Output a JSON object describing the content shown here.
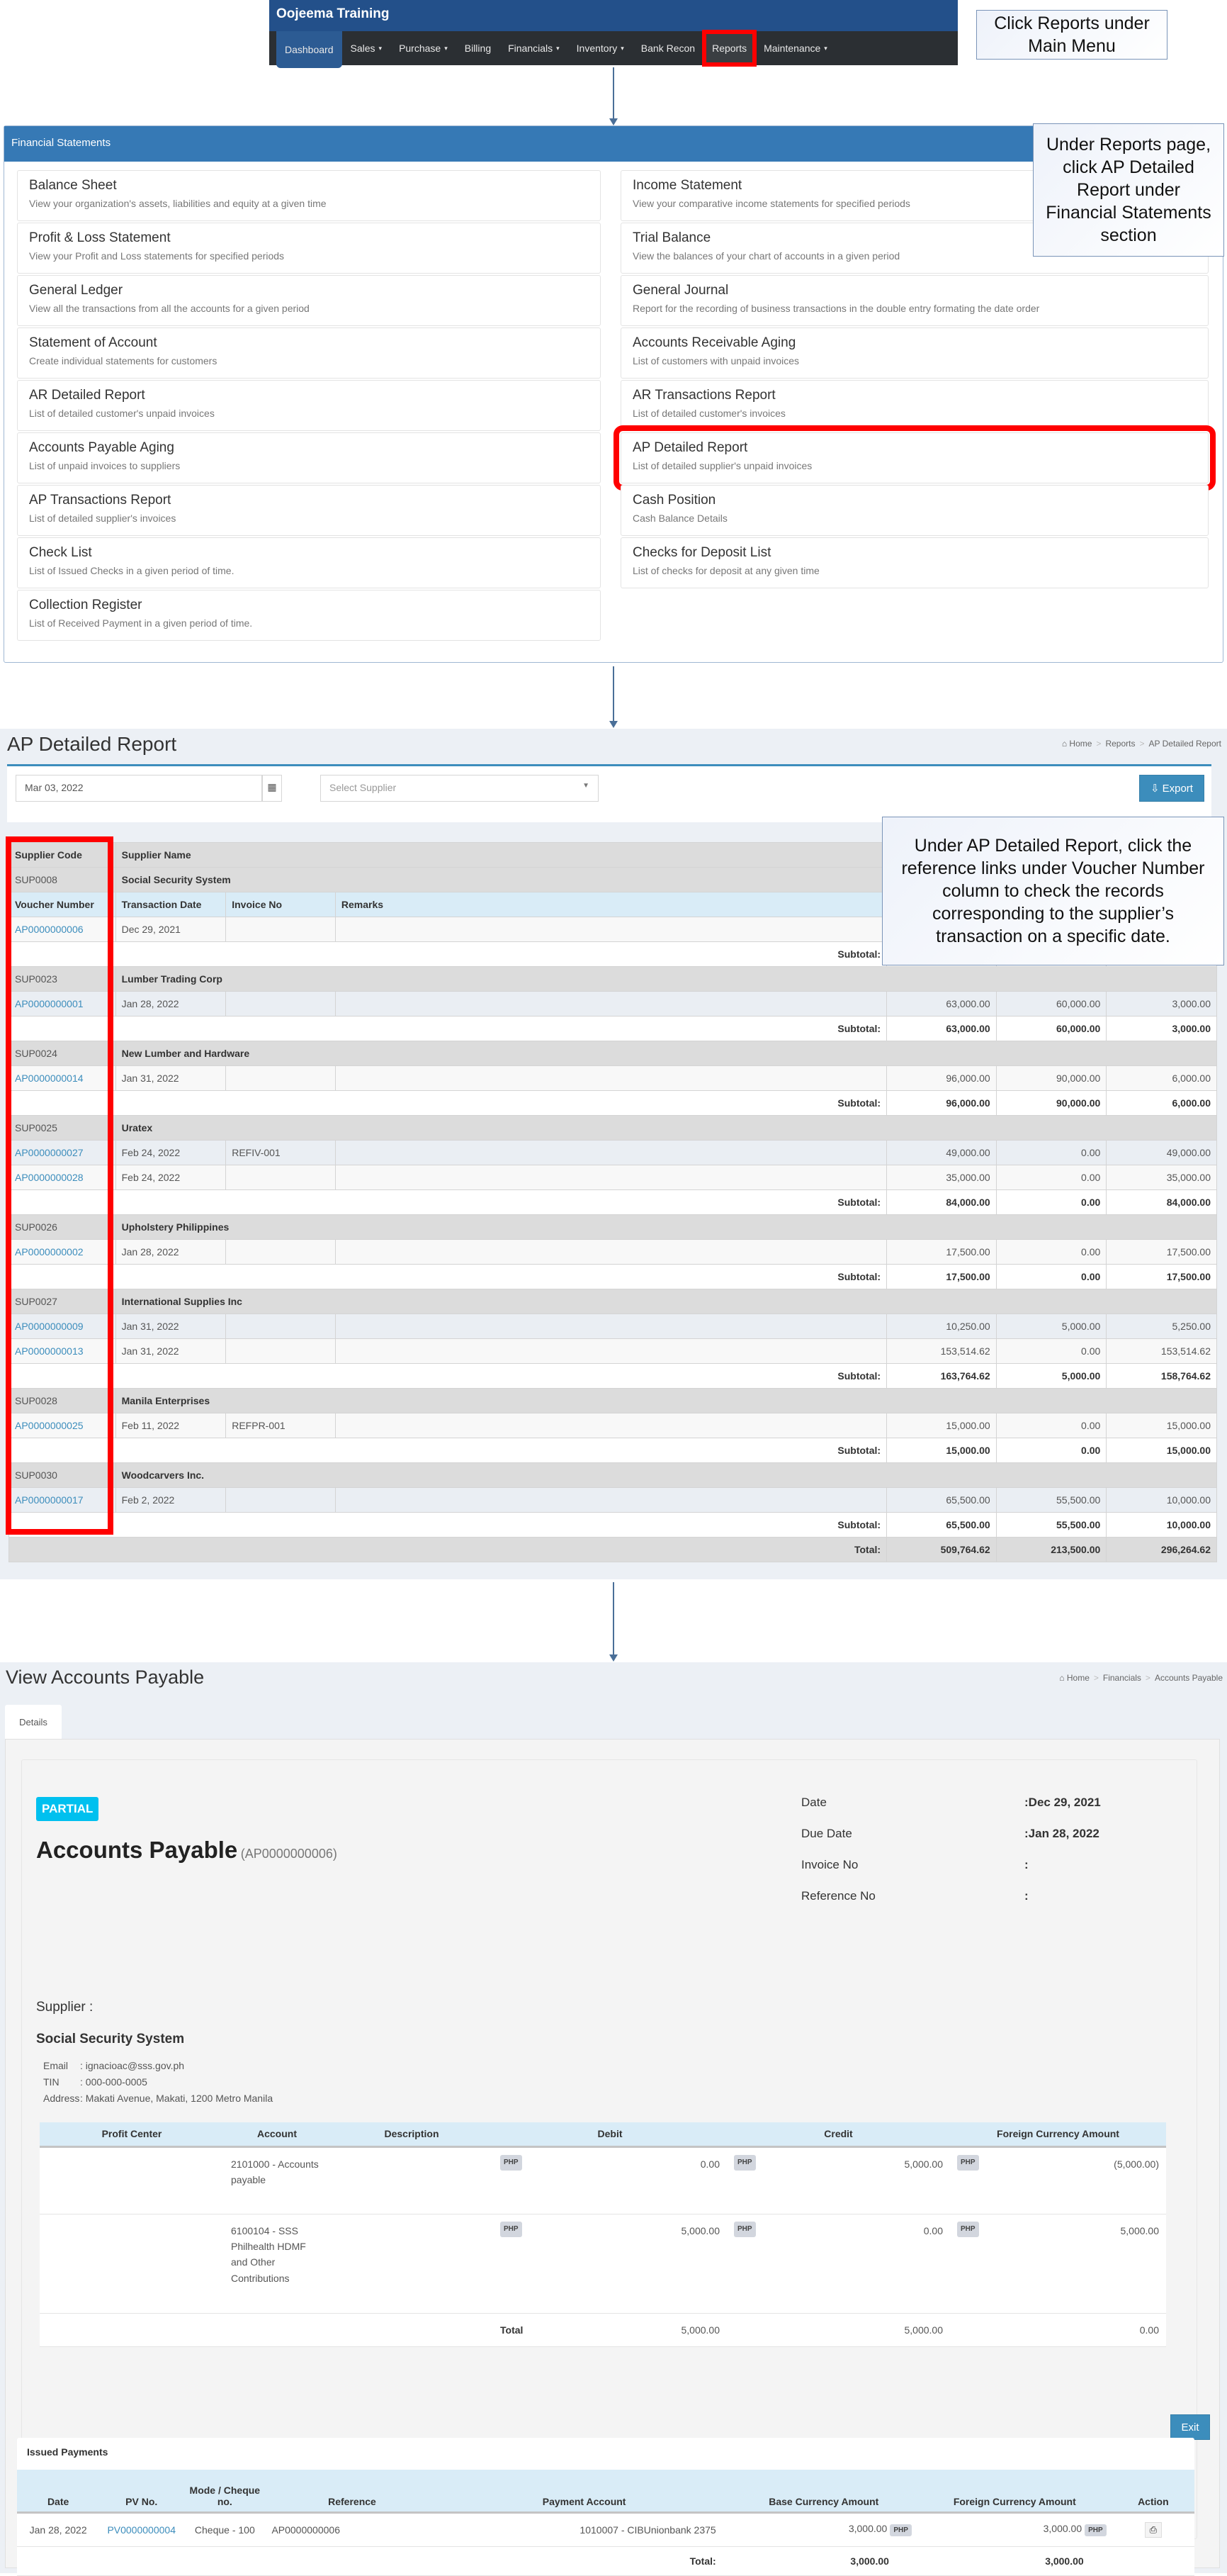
{
  "nav": {
    "brand": "Oojeema Training",
    "items": [
      {
        "label": "Dashboard",
        "caret": false
      },
      {
        "label": "Sales",
        "caret": true
      },
      {
        "label": "Purchase",
        "caret": true
      },
      {
        "label": "Billing",
        "caret": false
      },
      {
        "label": "Financials",
        "caret": true
      },
      {
        "label": "Inventory",
        "caret": true
      },
      {
        "label": "Bank Recon",
        "caret": false
      },
      {
        "label": "Reports",
        "caret": false
      },
      {
        "label": "Maintenance",
        "caret": true
      }
    ],
    "caret_glyph": "▾"
  },
  "callouts": {
    "step1": "Click Reports under Main Menu",
    "step2": "Under Reports page, click AP Detailed Report under Financial Statements section",
    "step3": "Under AP Detailed Report, click the reference links under Voucher Number column to check the records corresponding to the supplier’s transaction on a specific date."
  },
  "financial_statements": {
    "header": "Financial Statements",
    "left": [
      {
        "title": "Balance Sheet",
        "desc": "View your organization's assets, liabilities and equity at a given time"
      },
      {
        "title": "Profit & Loss Statement",
        "desc": "View your Profit and Loss statements for specified periods"
      },
      {
        "title": "General Ledger",
        "desc": "View all the transactions from all the accounts for a given period"
      },
      {
        "title": "Statement of Account",
        "desc": "Create individual statements for customers"
      },
      {
        "title": "AR Detailed Report",
        "desc": "List of detailed customer's unpaid invoices"
      },
      {
        "title": "Accounts Payable Aging",
        "desc": "List of unpaid invoices to suppliers"
      },
      {
        "title": "AP Transactions Report",
        "desc": "List of detailed supplier's invoices"
      },
      {
        "title": "Check List",
        "desc": "List of Issued Checks in a given period of time."
      },
      {
        "title": "Collection Register",
        "desc": "List of Received Payment in a given period of time."
      }
    ],
    "right": [
      {
        "title": "Income Statement",
        "desc": "View your comparative income statements for specified periods"
      },
      {
        "title": "Trial Balance",
        "desc": "View the balances of your chart of accounts in a given period"
      },
      {
        "title": "General Journal",
        "desc": "Report for the recording of business transactions in the double entry formating the date order"
      },
      {
        "title": "Accounts Receivable Aging",
        "desc": "List of customers with unpaid invoices"
      },
      {
        "title": "AR Transactions Report",
        "desc": "List of detailed customer's invoices"
      },
      {
        "title": "AP Detailed Report",
        "desc": "List of detailed supplier's unpaid invoices"
      },
      {
        "title": "Cash Position",
        "desc": "Cash Balance Details"
      },
      {
        "title": "Checks for Deposit List",
        "desc": "List of checks for deposit at any given time"
      }
    ]
  },
  "ap_detailed": {
    "title": "AP Detailed Report",
    "breadcrumb": [
      "Home",
      "Reports",
      "AP Detailed Report"
    ],
    "date_value": "Mar 03, 2022",
    "supplier_placeholder": "Select Supplier",
    "export_label": "Export",
    "headers": {
      "supplier_code": "Supplier Code",
      "supplier_name": "Supplier Name",
      "voucher": "Voucher Number",
      "txn_date": "Transaction Date",
      "invoice": "Invoice No",
      "remarks": "Remarks"
    },
    "subtotal_label": "Subtotal:",
    "total_label": "Total:",
    "suppliers": [
      {
        "code": "SUP0008",
        "name": "Social Security System",
        "rows": [
          {
            "voucher": "AP0000000006",
            "date": "Dec 29, 2021",
            "invoice": "",
            "remarks": "",
            "amount": "",
            "paid": "",
            "balance": ""
          }
        ],
        "subtotal": [
          "",
          "",
          ""
        ]
      },
      {
        "code": "SUP0023",
        "name": "Lumber Trading Corp",
        "rows": [
          {
            "voucher": "AP0000000001",
            "date": "Jan 28, 2022",
            "invoice": "",
            "remarks": "",
            "amount": "63,000.00",
            "paid": "60,000.00",
            "balance": "3,000.00"
          }
        ],
        "subtotal": [
          "63,000.00",
          "60,000.00",
          "3,000.00"
        ]
      },
      {
        "code": "SUP0024",
        "name": "New Lumber and Hardware",
        "rows": [
          {
            "voucher": "AP0000000014",
            "date": "Jan 31, 2022",
            "invoice": "",
            "remarks": "",
            "amount": "96,000.00",
            "paid": "90,000.00",
            "balance": "6,000.00"
          }
        ],
        "subtotal": [
          "96,000.00",
          "90,000.00",
          "6,000.00"
        ]
      },
      {
        "code": "SUP0025",
        "name": "Uratex",
        "rows": [
          {
            "voucher": "AP0000000027",
            "date": "Feb 24, 2022",
            "invoice": "REFIV-001",
            "remarks": "",
            "amount": "49,000.00",
            "paid": "0.00",
            "balance": "49,000.00"
          },
          {
            "voucher": "AP0000000028",
            "date": "Feb 24, 2022",
            "invoice": "",
            "remarks": "",
            "amount": "35,000.00",
            "paid": "0.00",
            "balance": "35,000.00"
          }
        ],
        "subtotal": [
          "84,000.00",
          "0.00",
          "84,000.00"
        ]
      },
      {
        "code": "SUP0026",
        "name": "Upholstery Philippines",
        "rows": [
          {
            "voucher": "AP0000000002",
            "date": "Jan 28, 2022",
            "invoice": "",
            "remarks": "",
            "amount": "17,500.00",
            "paid": "0.00",
            "balance": "17,500.00"
          }
        ],
        "subtotal": [
          "17,500.00",
          "0.00",
          "17,500.00"
        ]
      },
      {
        "code": "SUP0027",
        "name": "International Supplies Inc",
        "rows": [
          {
            "voucher": "AP0000000009",
            "date": "Jan 31, 2022",
            "invoice": "",
            "remarks": "",
            "amount": "10,250.00",
            "paid": "5,000.00",
            "balance": "5,250.00"
          },
          {
            "voucher": "AP0000000013",
            "date": "Jan 31, 2022",
            "invoice": "",
            "remarks": "",
            "amount": "153,514.62",
            "paid": "0.00",
            "balance": "153,514.62"
          }
        ],
        "subtotal": [
          "163,764.62",
          "5,000.00",
          "158,764.62"
        ]
      },
      {
        "code": "SUP0028",
        "name": "Manila Enterprises",
        "rows": [
          {
            "voucher": "AP0000000025",
            "date": "Feb 11, 2022",
            "invoice": "REFPR-001",
            "remarks": "",
            "amount": "15,000.00",
            "paid": "0.00",
            "balance": "15,000.00"
          }
        ],
        "subtotal": [
          "15,000.00",
          "0.00",
          "15,000.00"
        ]
      },
      {
        "code": "SUP0030",
        "name": "Woodcarvers Inc.",
        "rows": [
          {
            "voucher": "AP0000000017",
            "date": "Feb 2, 2022",
            "invoice": "",
            "remarks": "",
            "amount": "65,500.00",
            "paid": "55,500.00",
            "balance": "10,000.00"
          }
        ],
        "subtotal": [
          "65,500.00",
          "55,500.00",
          "10,000.00"
        ]
      }
    ],
    "total": [
      "509,764.62",
      "213,500.00",
      "296,264.62"
    ]
  },
  "view_ap": {
    "title": "View Accounts Payable",
    "breadcrumb": [
      "Home",
      "Financials",
      "Accounts Payable"
    ],
    "tab": "Details",
    "status": "PARTIAL",
    "doc_title": "Accounts Payable",
    "doc_ref": "(AP0000000006)",
    "meta": [
      {
        "label": "Date",
        "value": ":Dec 29, 2021"
      },
      {
        "label": "Due Date",
        "value": ":Jan 28, 2022"
      },
      {
        "label": "Invoice No",
        "value": ":"
      },
      {
        "label": "Reference No",
        "value": ":"
      }
    ],
    "supplier_label": "Supplier :",
    "supplier_name": "Social Security System",
    "supplier_details": [
      {
        "label": "Email",
        "value": ": ignacioac@sss.gov.ph"
      },
      {
        "label": "TIN",
        "value": ": 000-000-0005"
      },
      {
        "label": "Address",
        "value": ": Makati Avenue, Makati, 1200 Metro Manila"
      }
    ],
    "lines_headers": [
      "Profit Center",
      "Account",
      "Description",
      "Debit",
      "Credit",
      "Foreign Currency Amount"
    ],
    "currency": "PHP",
    "lines": [
      {
        "profit_center": "",
        "account": "2101000 - Accounts payable",
        "description": "",
        "debit": "0.00",
        "credit": "5,000.00",
        "foreign": "(5,000.00)"
      },
      {
        "profit_center": "",
        "account": "6100104 - SSS Philhealth HDMF and Other Contributions",
        "description": "",
        "debit": "5,000.00",
        "credit": "0.00",
        "foreign": "5,000.00"
      }
    ],
    "lines_total_label": "Total",
    "lines_total": {
      "debit": "5,000.00",
      "credit": "5,000.00",
      "foreign": "0.00"
    },
    "exit_label": "Exit",
    "issued_payments": {
      "title": "Issued Payments",
      "headers": [
        "Date",
        "PV No.",
        "Mode / Cheque no.",
        "Reference",
        "Payment Account",
        "Base Currency Amount",
        "Foreign Currency Amount",
        "Action"
      ],
      "rows": [
        {
          "date": "Jan 28, 2022",
          "pv": "PV0000000004",
          "mode": "Cheque - 100",
          "reference": "AP0000000006",
          "account": "1010007 - CIBUnionbank 2375",
          "base": "3,000.00",
          "foreign": "3,000.00",
          "action_icon": "print-icon"
        }
      ],
      "total_label": "Total:",
      "total_base": "3,000.00",
      "total_foreign": "3,000.00"
    }
  }
}
